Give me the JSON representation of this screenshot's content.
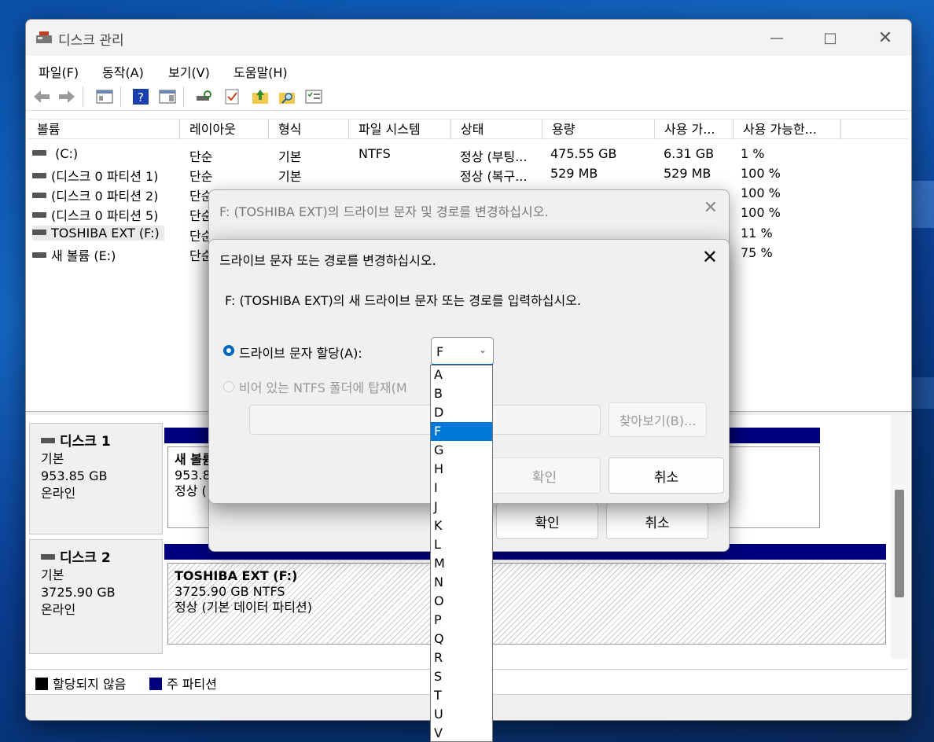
{
  "window": {
    "title": "디스크 관리"
  },
  "menu": [
    "파일(F)",
    "동작(A)",
    "보기(V)",
    "도움말(H)"
  ],
  "list": {
    "headers": [
      "볼륨",
      "레이아웃",
      "형식",
      "파일 시스템",
      "상태",
      "용량",
      "사용 가...",
      "사용 가능한..."
    ],
    "rows": [
      {
        "vol": " (C:)",
        "layout": "단순",
        "type": "기본",
        "fs": "NTFS",
        "status": "정상 (부팅...",
        "cap": "475.55 GB",
        "free": "6.31 GB",
        "pct": "1 %"
      },
      {
        "vol": "(디스크 0 파티션 1)",
        "layout": "단순",
        "type": "기본",
        "fs": "",
        "status": "정상 (복구...",
        "cap": "529 MB",
        "free": "529 MB",
        "pct": "100 %"
      },
      {
        "vol": "(디스크 0 파티션 2)",
        "layout": "단순",
        "type": "",
        "fs": "",
        "status": "",
        "cap": "",
        "free": "",
        "pct": "100 %"
      },
      {
        "vol": "(디스크 0 파티션 5)",
        "layout": "단순",
        "type": "",
        "fs": "",
        "status": "",
        "cap": "",
        "free": "",
        "pct": "100 %"
      },
      {
        "vol": "TOSHIBA EXT (F:)",
        "layout": "단순",
        "type": "",
        "fs": "",
        "status": "",
        "cap": "",
        "free": "",
        "pct": "11 %"
      },
      {
        "vol": "새 볼륨 (E:)",
        "layout": "단순",
        "type": "",
        "fs": "",
        "status": "",
        "cap": "",
        "free": "",
        "pct": "75 %"
      }
    ]
  },
  "disks": [
    {
      "name": "디스크 1",
      "kind": "기본",
      "size": "953.85 GB",
      "state": "온라인",
      "part_name": "새 볼륨",
      "part_size": "953.8",
      "part_status": "정상 ("
    },
    {
      "name": "디스크 2",
      "kind": "기본",
      "size": "3725.90 GB",
      "state": "온라인",
      "part_name": "TOSHIBA EXT  (F:)",
      "part_size": "3725.90 GB NTFS",
      "part_status": "정상 (기본 데이터 파티션)"
    }
  ],
  "legend": {
    "unallocated": "할당되지 않음",
    "primary": "주 파티션",
    "unallocated_color": "#000000",
    "primary_color": "#00007f"
  },
  "dialog1": {
    "title": "F: (TOSHIBA EXT)의 드라이브 문자 및 경로를 변경하십시오.",
    "ok": "확인",
    "cancel": "취소"
  },
  "dialog2": {
    "title": "드라이브 문자 또는 경로를 변경하십시오.",
    "prompt": "F: (TOSHIBA EXT)의 새 드라이브 문자 또는 경로를 입력하십시오.",
    "opt_assign": "드라이브 문자 할당(A):",
    "opt_mount": "비어 있는 NTFS 폴더에 탑재(M",
    "selected_letter": "F",
    "browse": "찾아보기(B)...",
    "ok": "확인",
    "cancel": "취소"
  },
  "dropdown": [
    "A",
    "B",
    "D",
    "F",
    "G",
    "H",
    "I",
    "J",
    "K",
    "L",
    "M",
    "N",
    "O",
    "P",
    "Q",
    "R",
    "S",
    "T",
    "U",
    "V"
  ],
  "colors": {
    "accent": "#0067c0",
    "selection": "#0078d7"
  }
}
